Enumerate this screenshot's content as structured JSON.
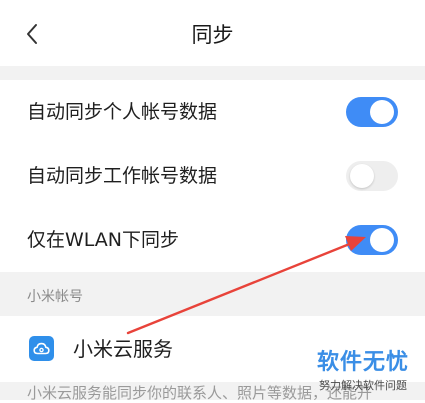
{
  "header": {
    "title": "同步",
    "back_icon": "chevron-left-icon"
  },
  "sync_settings": [
    {
      "label": "自动同步个人帐号数据",
      "enabled": true
    },
    {
      "label": "自动同步工作帐号数据",
      "enabled": false
    },
    {
      "label": "仅在WLAN下同步",
      "enabled": true
    }
  ],
  "account_section": {
    "label": "小米帐号",
    "service_label": "小米云服务",
    "service_icon": "cloud-icon",
    "description": "小米云服务能同步你的联系人、照片等数据，还能开"
  },
  "watermark": {
    "main": "软件无忧",
    "sub": "努力解决软件问题"
  },
  "colors": {
    "accent": "#3f8cf6",
    "toggle_off": "#eeeeee",
    "divider_bg": "#f2f2f2",
    "annotation_arrow": "#e8433a",
    "watermark": "#3a8ee6"
  }
}
